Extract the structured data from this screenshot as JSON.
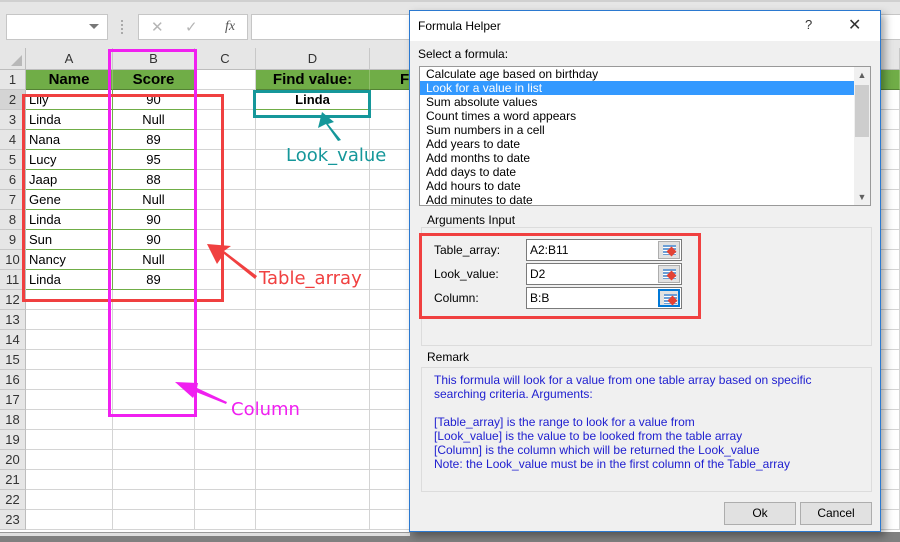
{
  "formula_bar": {
    "name_box_value": "",
    "cancel_icon": "x-icon",
    "enter_icon": "check-icon",
    "fx_label": "fx",
    "formula_value": ""
  },
  "sheet": {
    "columns": [
      "A",
      "B",
      "C",
      "D"
    ],
    "rows": [
      "1",
      "2",
      "3",
      "4",
      "5",
      "6",
      "7",
      "8",
      "9",
      "10",
      "11",
      "12",
      "13",
      "14",
      "15",
      "16",
      "17",
      "18",
      "19",
      "20",
      "21",
      "22",
      "23"
    ],
    "headers": {
      "name": "Name",
      "score": "Score",
      "find_value": "Find value:",
      "first": "Firs"
    },
    "table": [
      {
        "name": "Lily",
        "score": "90"
      },
      {
        "name": "Linda",
        "score": "Null"
      },
      {
        "name": "Nana",
        "score": "89"
      },
      {
        "name": "Lucy",
        "score": "95"
      },
      {
        "name": "Jaap",
        "score": "88"
      },
      {
        "name": "Gene",
        "score": "Null"
      },
      {
        "name": "Linda",
        "score": "90"
      },
      {
        "name": "Sun",
        "score": "90"
      },
      {
        "name": "Nancy",
        "score": "Null"
      },
      {
        "name": "Linda",
        "score": "89"
      }
    ],
    "lookup_value": "Linda"
  },
  "annotations": {
    "table_array": {
      "label": "Table_array",
      "color": "#f04040"
    },
    "look_value": {
      "label": "Look_value",
      "color": "#15979a"
    },
    "column": {
      "label": "Column",
      "color": "#f020f0"
    }
  },
  "dialog": {
    "title": "Formula Helper",
    "help_label": "?",
    "close_label": "✕",
    "select_label": "Select a formula:",
    "formulas": [
      "Calculate age based on birthday",
      "Look for a value in list",
      "Sum absolute values",
      "Count times a word appears",
      "Sum numbers in a cell",
      "Add years to date",
      "Add months to date",
      "Add days to date",
      "Add hours to date",
      "Add minutes to date"
    ],
    "selected_index": 1,
    "arguments_title": "Arguments Input",
    "arguments": [
      {
        "label": "Table_array:",
        "value": "A2:B11"
      },
      {
        "label": "Look_value:",
        "value": "D2"
      },
      {
        "label": "Column:",
        "value": "B:B"
      }
    ],
    "remark_title": "Remark",
    "remark_lines": [
      "This formula will look for a value from one table array based on specific",
      "searching criteria. Arguments:",
      "",
      "[Table_array] is the range to look for a value from",
      "[Look_value] is the value to be looked from the table array",
      "[Column] is the column which will be returned the Look_value",
      "Note: the Look_value must be in the first column of the Table_array"
    ],
    "ok_label": "Ok",
    "cancel_label": "Cancel",
    "accent": "#2b79d0",
    "selection_color": "#3399ff",
    "remark_color": "#2020d0"
  }
}
